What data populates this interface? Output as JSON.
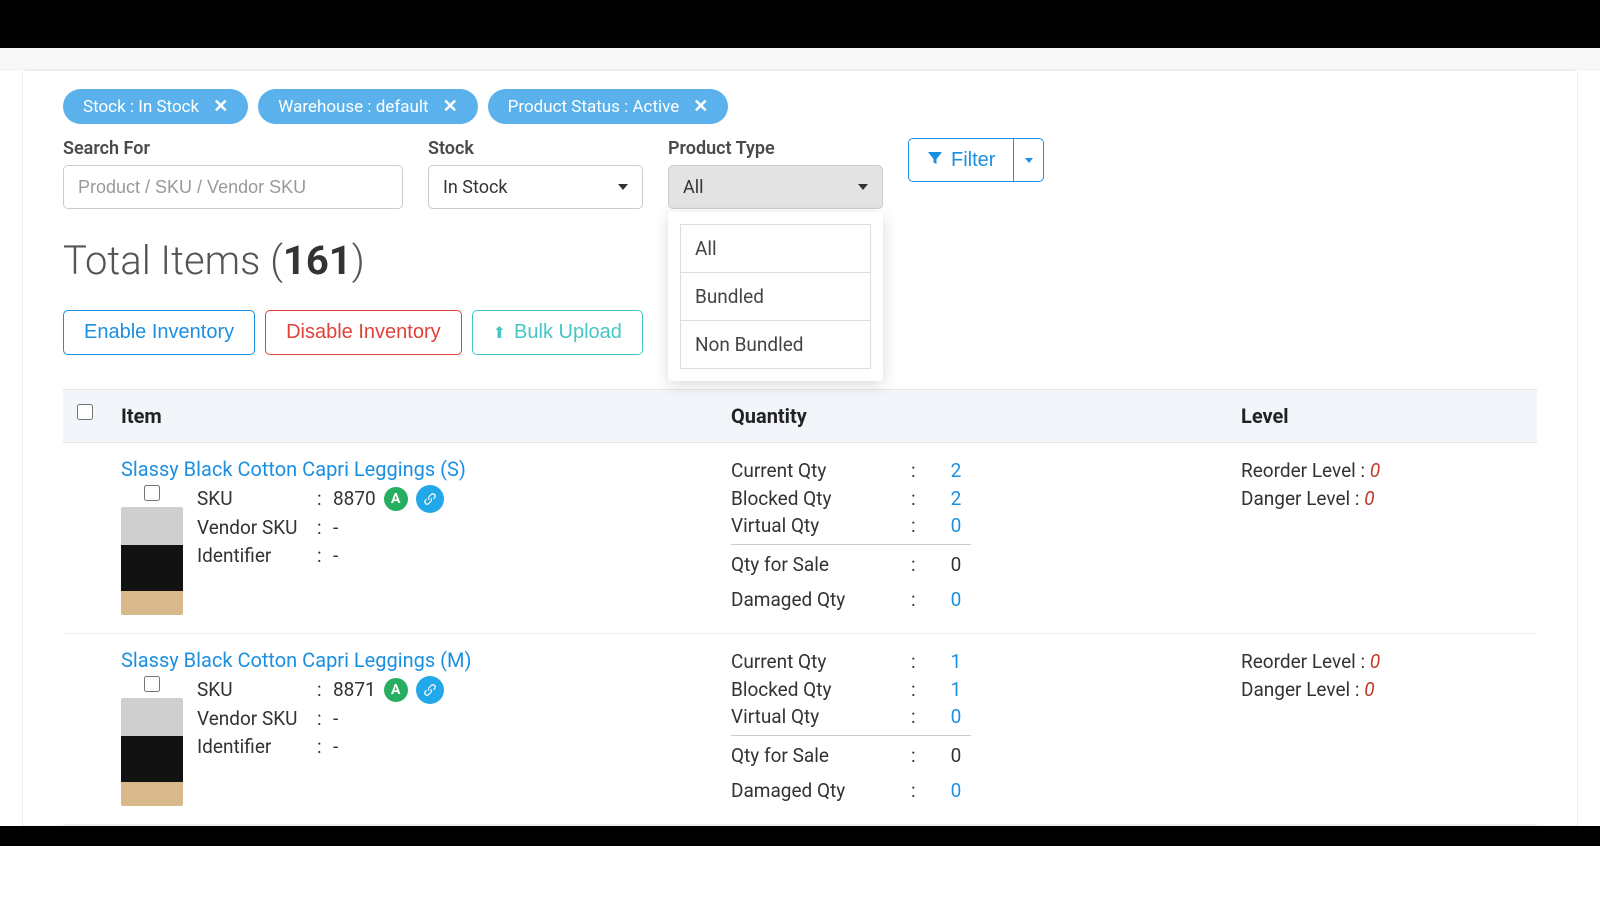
{
  "chips": [
    {
      "label": "Stock : In Stock"
    },
    {
      "label": "Warehouse : default"
    },
    {
      "label": "Product Status : Active"
    }
  ],
  "filters": {
    "search_label": "Search For",
    "search_placeholder": "Product / SKU / Vendor SKU",
    "stock_label": "Stock",
    "stock_value": "In Stock",
    "product_type_label": "Product Type",
    "product_type_value": "All",
    "filter_button": "Filter",
    "product_type_options": [
      "All",
      "Bundled",
      "Non Bundled"
    ]
  },
  "totals": {
    "prefix": "Total Items (",
    "count": "161",
    "suffix": ")"
  },
  "actions": {
    "enable": "Enable Inventory",
    "disable": "Disable Inventory",
    "bulk_upload": "Bulk Upload"
  },
  "columns": {
    "item": "Item",
    "quantity": "Quantity",
    "level": "Level"
  },
  "qty_labels": {
    "current": "Current Qty",
    "blocked": "Blocked Qty",
    "virtual": "Virtual Qty",
    "for_sale": "Qty for Sale",
    "damaged": "Damaged Qty"
  },
  "level_labels": {
    "reorder": "Reorder Level :",
    "danger": "Danger Level  :"
  },
  "kv_labels": {
    "sku": "SKU",
    "vendor_sku": "Vendor SKU",
    "identifier": "Identifier"
  },
  "badges": {
    "a": "A"
  },
  "items": [
    {
      "title": "Slassy Black Cotton Capri Leggings (S)",
      "sku": "8870",
      "vendor_sku": "-",
      "identifier": "-",
      "qty": {
        "current": "2",
        "blocked": "2",
        "virtual": "0",
        "for_sale": "0",
        "damaged": "0"
      },
      "level": {
        "reorder": "0",
        "danger": "0"
      }
    },
    {
      "title": "Slassy Black Cotton Capri Leggings (M)",
      "sku": "8871",
      "vendor_sku": "-",
      "identifier": "-",
      "qty": {
        "current": "1",
        "blocked": "1",
        "virtual": "0",
        "for_sale": "0",
        "damaged": "0"
      },
      "level": {
        "reorder": "0",
        "danger": "0"
      }
    }
  ]
}
